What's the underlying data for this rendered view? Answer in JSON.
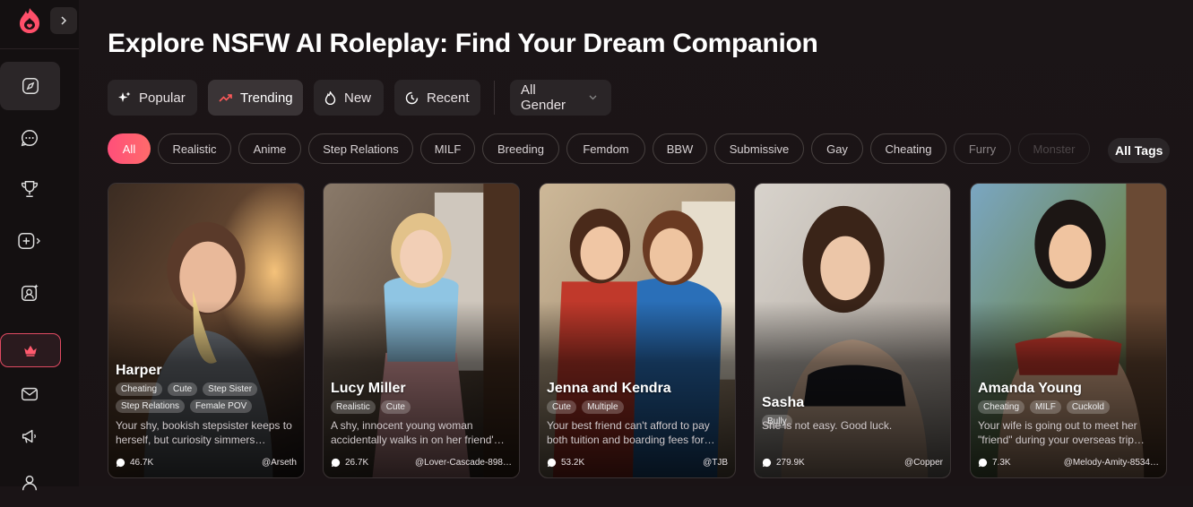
{
  "app": {
    "title": "Explore NSFW AI Roleplay: Find Your Dream Companion"
  },
  "sidebar": {
    "items": [
      {
        "icon": "compass-icon"
      },
      {
        "icon": "chat-icon"
      },
      {
        "icon": "trophy-icon"
      },
      {
        "icon": "create-icon"
      },
      {
        "icon": "user-star-icon"
      },
      {
        "icon": "crown-icon"
      },
      {
        "icon": "mail-icon"
      },
      {
        "icon": "megaphone-icon"
      },
      {
        "icon": "user-icon"
      }
    ]
  },
  "filters": {
    "sort": [
      {
        "label": "Popular",
        "icon": "sparkle-icon"
      },
      {
        "label": "Trending",
        "icon": "trend-icon"
      },
      {
        "label": "New",
        "icon": "flame-icon"
      },
      {
        "label": "Recent",
        "icon": "clock-icon"
      }
    ],
    "active_sort": "Trending",
    "gender": "All Gender"
  },
  "tags": {
    "items": [
      "All",
      "Realistic",
      "Anime",
      "Step Relations",
      "MILF",
      "Breeding",
      "Femdom",
      "BBW",
      "Submissive",
      "Gay",
      "Cheating",
      "Furry",
      "Monster"
    ],
    "active": "All",
    "all_tags_label": "All Tags"
  },
  "cards": [
    {
      "name": "Harper",
      "tags": [
        "Cheating",
        "Cute",
        "Step Sister",
        "Step Relations",
        "Female POV"
      ],
      "desc": "Your shy, bookish stepsister keeps to herself, but curiosity simmers…",
      "views": "46.7K",
      "author": "@Arseth"
    },
    {
      "name": "Lucy Miller",
      "tags": [
        "Realistic",
        "Cute"
      ],
      "desc": "A shy, innocent young woman accidentally walks in on her friend'…",
      "views": "26.7K",
      "author": "@Lover-Cascade-898…"
    },
    {
      "name": "Jenna and Kendra",
      "tags": [
        "Cute",
        "Multiple"
      ],
      "desc": "Your best friend can't afford to pay both tuition and boarding fees for…",
      "views": "53.2K",
      "author": "@TJB"
    },
    {
      "name": "Sasha",
      "tags": [
        "Bully"
      ],
      "desc": "She is not easy. Good luck.",
      "views": "279.9K",
      "author": "@Copper"
    },
    {
      "name": "Amanda Young",
      "tags": [
        "Cheating",
        "MILF",
        "Cuckold"
      ],
      "desc": "Your wife is going out to meet her \"friend\" during your overseas trip…",
      "views": "7.3K",
      "author": "@Melody-Amity-8534…"
    }
  ],
  "colors": {
    "accent": "#ff4f7a",
    "background": "#1a1416",
    "card_border": "#3a3334"
  }
}
